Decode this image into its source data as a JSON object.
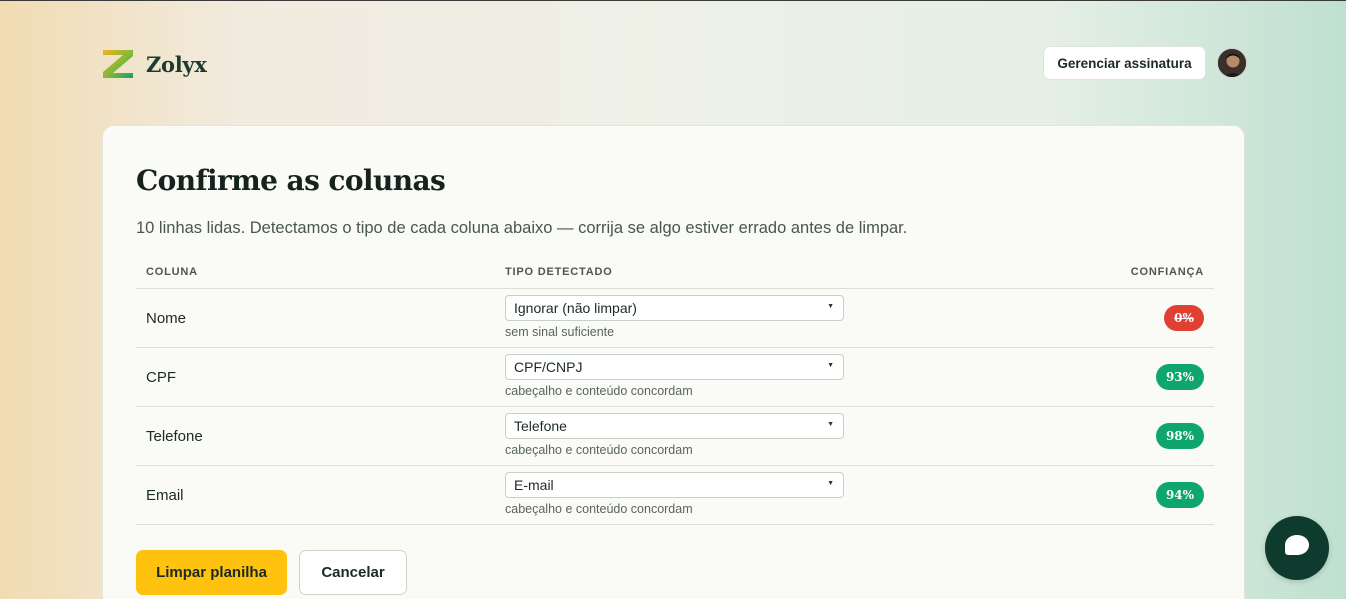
{
  "header": {
    "brand": "Zolyx",
    "manage_label": "Gerenciar assinatura"
  },
  "page": {
    "title": "Confirme as colunas",
    "subtitle": "10 linhas lidas. Detectamos o tipo de cada coluna abaixo — corrija se algo estiver errado antes de limpar."
  },
  "table": {
    "headers": {
      "column": "COLUNA",
      "type": "TIPO DETECTADO",
      "confidence": "CONFIANÇA"
    },
    "rows": [
      {
        "name": "Nome",
        "type": "Ignorar (não limpar)",
        "hint": "sem sinal suficiente",
        "confidence": "0%",
        "status": "low"
      },
      {
        "name": "CPF",
        "type": "CPF/CNPJ",
        "hint": "cabeçalho e conteúdo concordam",
        "confidence": "93%",
        "status": "high"
      },
      {
        "name": "Telefone",
        "type": "Telefone",
        "hint": "cabeçalho e conteúdo concordam",
        "confidence": "98%",
        "status": "high"
      },
      {
        "name": "Email",
        "type": "E-mail",
        "hint": "cabeçalho e conteúdo concordam",
        "confidence": "94%",
        "status": "high"
      }
    ]
  },
  "actions": {
    "primary_label": "Limpar planilha",
    "secondary_label": "Cancelar"
  },
  "icons": {
    "logo": "zolyx-logo-icon",
    "caret": "chevron-down-icon",
    "chat": "chat-bubble-icon"
  },
  "colors": {
    "accent": "#ffc20e",
    "brand_dark": "#0f3b2e",
    "success": "#0ea56f",
    "danger": "#e03f33"
  }
}
